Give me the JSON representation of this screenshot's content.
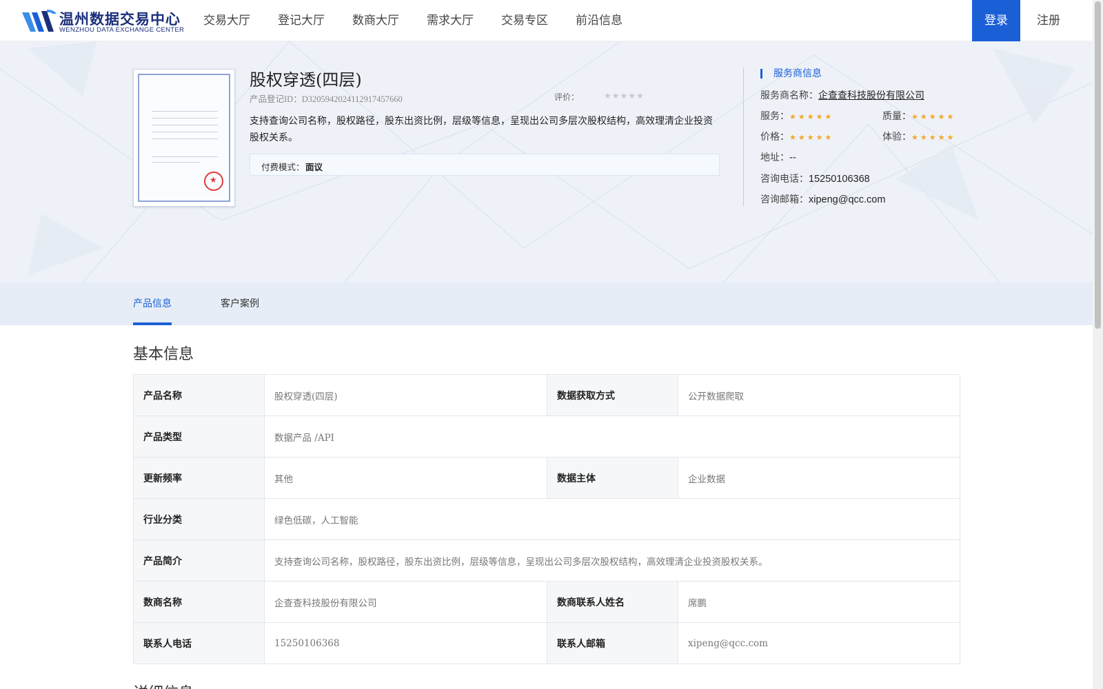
{
  "header": {
    "logo_cn": "温州数据交易中心",
    "logo_en": "WENZHOU DATA EXCHANGE CENTER",
    "nav": [
      "交易大厅",
      "登记大厅",
      "数商大厅",
      "需求大厅",
      "交易专区",
      "前沿信息"
    ],
    "login_label": "登录",
    "register_label": "注册"
  },
  "product": {
    "title": "股权穿透(四层)",
    "reg_id": "产品登记ID：D32059420241129174576​60",
    "rating_label": "评价：",
    "rating_stars": "★★★★★",
    "rating_value": 0,
    "description": "支持查询公司名称，股权路径，股东出资比例，层级等信息，呈现出公司多层次股权结构，高效理清企业投资股权关系。",
    "fee_label": "付费模式：",
    "fee_value": "面议"
  },
  "provider": {
    "section_title": "服务商信息",
    "name_label": "服务商名称：",
    "name_value": "企查查科技股份有限公司",
    "service_label": "服务：",
    "quality_label": "质量：",
    "price_label": "价格：",
    "experience_label": "体验：",
    "stars": "★★★★★",
    "service_rating": 5,
    "quality_rating": 5,
    "price_rating": 5,
    "experience_rating": 5,
    "address_label": "地址：",
    "address_value": "--",
    "phone_label": "咨询电话：",
    "phone_value": "15250106368",
    "email_label": "咨询邮箱：",
    "email_value": "xipeng@qcc.com"
  },
  "tabs": [
    {
      "label": "产品信息",
      "active": true
    },
    {
      "label": "客户案例",
      "active": false
    }
  ],
  "basic_info": {
    "title": "基本信息",
    "rows": {
      "product_name_k": "产品名称",
      "product_name_v": "股权穿透(四层)",
      "acquire_k": "数据获取方式",
      "acquire_v": "公开数据爬取",
      "type_k": "产品类型",
      "type_v": "数据产品 /API",
      "freq_k": "更新频率",
      "freq_v": "其他",
      "subject_k": "数据主体",
      "subject_v": "企业数据",
      "industry_k": "行业分类",
      "industry_v": "绿色低碳，人工智能",
      "intro_k": "产品简介",
      "intro_v": "支持查询公司名称，股权路径，股东出资比例，层级等信息，呈现出公司多层次股权结构，高效理清企业投资股权关系。",
      "vendor_k": "数商名称",
      "vendor_v": "企查查科技股份有限公司",
      "contact_k": "数商联系人姓名",
      "contact_v": "席鹏",
      "phone_k": "联系人电话",
      "phone_v": "15250106368",
      "email_k": "联系人邮箱",
      "email_v": "xipeng@qcc.com"
    }
  },
  "next_section_title": "详细信息",
  "colors": {
    "accent": "#1b5fd6",
    "star_gold": "#f5a623",
    "hero_bg": "#eef2f8"
  }
}
